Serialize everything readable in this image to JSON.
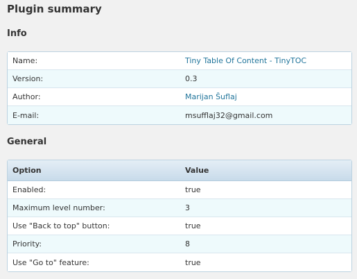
{
  "page_title": "Plugin summary",
  "info": {
    "title": "Info",
    "rows": [
      {
        "label": "Name:",
        "value": "Tiny Table Of Content - TinyTOC"
      },
      {
        "label": "Version:",
        "value": "0.3"
      },
      {
        "label": "Author:",
        "value": "Marijan Šuflaj"
      },
      {
        "label": "E-mail:",
        "value": "msufflaj32@gmail.com"
      }
    ]
  },
  "general": {
    "title": "General",
    "header": {
      "option": "Option",
      "value": "Value"
    },
    "rows": [
      {
        "label": "Enabled:",
        "value": "true"
      },
      {
        "label": "Maximum level number:",
        "value": "3"
      },
      {
        "label": "Use \"Back to top\" button:",
        "value": "true"
      },
      {
        "label": "Priority:",
        "value": "8"
      },
      {
        "label": "Use \"Go to\" feature:",
        "value": "true"
      }
    ]
  },
  "colors": {
    "link": "#21759b",
    "row_alt": "#eefafc",
    "border": "#bcd2e0"
  }
}
